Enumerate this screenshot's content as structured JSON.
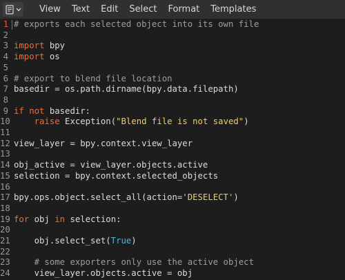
{
  "menu": {
    "items": [
      "View",
      "Text",
      "Edit",
      "Select",
      "Format",
      "Templates"
    ]
  },
  "editor": {
    "active_line": 1,
    "lines": [
      {
        "n": "1",
        "tokens": [
          {
            "t": "com",
            "v": "# exports each selected object into its own file"
          }
        ]
      },
      {
        "n": "2",
        "tokens": []
      },
      {
        "n": "3",
        "tokens": [
          {
            "t": "kw",
            "v": "import"
          },
          {
            "t": "def",
            "v": " bpy"
          }
        ]
      },
      {
        "n": "4",
        "tokens": [
          {
            "t": "kw",
            "v": "import"
          },
          {
            "t": "def",
            "v": " os"
          }
        ]
      },
      {
        "n": "5",
        "tokens": []
      },
      {
        "n": "6",
        "tokens": [
          {
            "t": "com",
            "v": "# export to blend file location"
          }
        ]
      },
      {
        "n": "7",
        "tokens": [
          {
            "t": "def",
            "v": "basedir = os.path.dirname(bpy.data.filepath)"
          }
        ]
      },
      {
        "n": "8",
        "tokens": []
      },
      {
        "n": "9",
        "tokens": [
          {
            "t": "kw",
            "v": "if"
          },
          {
            "t": "def",
            "v": " "
          },
          {
            "t": "kw",
            "v": "not"
          },
          {
            "t": "def",
            "v": " basedir:"
          }
        ]
      },
      {
        "n": "10",
        "tokens": [
          {
            "t": "def",
            "v": "    "
          },
          {
            "t": "kw",
            "v": "raise"
          },
          {
            "t": "def",
            "v": " Exception("
          },
          {
            "t": "str",
            "v": "\"Blend file is not saved\""
          },
          {
            "t": "def",
            "v": ")"
          }
        ]
      },
      {
        "n": "11",
        "tokens": []
      },
      {
        "n": "12",
        "tokens": [
          {
            "t": "def",
            "v": "view_layer = bpy.context.view_layer"
          }
        ]
      },
      {
        "n": "13",
        "tokens": []
      },
      {
        "n": "14",
        "tokens": [
          {
            "t": "def",
            "v": "obj_active = view_layer.objects.active"
          }
        ]
      },
      {
        "n": "15",
        "tokens": [
          {
            "t": "def",
            "v": "selection = bpy.context.selected_objects"
          }
        ]
      },
      {
        "n": "16",
        "tokens": []
      },
      {
        "n": "17",
        "tokens": [
          {
            "t": "def",
            "v": "bpy.ops.object.select_all(action="
          },
          {
            "t": "str",
            "v": "'DESELECT'"
          },
          {
            "t": "def",
            "v": ")"
          }
        ]
      },
      {
        "n": "18",
        "tokens": []
      },
      {
        "n": "19",
        "tokens": [
          {
            "t": "kw",
            "v": "for"
          },
          {
            "t": "def",
            "v": " obj "
          },
          {
            "t": "kw",
            "v": "in"
          },
          {
            "t": "def",
            "v": " selection:"
          }
        ]
      },
      {
        "n": "20",
        "tokens": []
      },
      {
        "n": "21",
        "tokens": [
          {
            "t": "def",
            "v": "    obj.select_set("
          },
          {
            "t": "num",
            "v": "True"
          },
          {
            "t": "def",
            "v": ")"
          }
        ]
      },
      {
        "n": "22",
        "tokens": []
      },
      {
        "n": "23",
        "tokens": [
          {
            "t": "def",
            "v": "    "
          },
          {
            "t": "com",
            "v": "# some exporters only use the active object"
          }
        ]
      },
      {
        "n": "24",
        "tokens": [
          {
            "t": "def",
            "v": "    view_layer.objects.active = obj"
          }
        ]
      }
    ]
  }
}
